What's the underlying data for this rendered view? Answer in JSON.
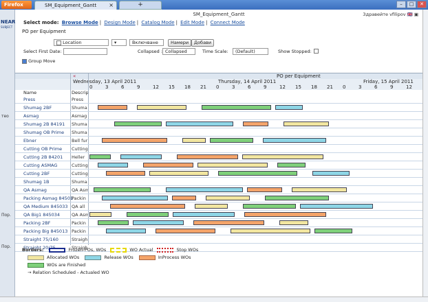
{
  "browser": {
    "menu_label": "Firefox",
    "tab_title": "SM_Equipment_Gantt",
    "new_tab_label": "+"
  },
  "logo": {
    "name": "NEARSOFT",
    "sub": "SUBJECT"
  },
  "left_labels": [
    "теo",
    "Пор.",
    "Пор."
  ],
  "app": {
    "title": "SM_Equipment_Gantt",
    "greeting": "Здравейте vfilipov",
    "mode_label": "Select mode:",
    "modes": [
      "Browse Mode",
      "Design Mode",
      "Catalog Mode",
      "Edit Mode",
      "Connect Mode"
    ],
    "page_heading": "PO per Equipment"
  },
  "toolbar": {
    "location_label": "Location",
    "location_value": "",
    "filter_value": "Включване",
    "search_button": "Намери",
    "add_button": "Добави",
    "first_date_label": "Select First Date:",
    "collapsed_label": "Collapsed :",
    "collapsed_value": "Collapsed",
    "time_scale_label": "Time Scale:",
    "time_scale_value": "(Default)",
    "show_stopped_label": "Show Stopped:",
    "group_move_label": "Group Move"
  },
  "gantt": {
    "banner": "PO per Equipment",
    "days": [
      "Wednesday, 13 April 2011",
      "Thursday, 14 April 2011",
      "Friday, 15 April 2011"
    ],
    "hours": [
      "0",
      "3",
      "6",
      "9",
      "12",
      "15",
      "18",
      "21",
      "0",
      "3",
      "6",
      "9",
      "12",
      "15",
      "18",
      "21",
      "0",
      "3",
      "6",
      "9",
      "12"
    ],
    "col_name": "Name",
    "col_desc": "Descrip",
    "rows": [
      {
        "name": "Press",
        "desc": "Press"
      },
      {
        "name": "Shumag 2BF",
        "desc": "Shuma"
      },
      {
        "name": "Asmag",
        "desc": "Asmag"
      },
      {
        "name": "Shumag 2B 84191",
        "desc": "Shuma"
      },
      {
        "name": "Shumag OB Prime",
        "desc": "Shuma"
      },
      {
        "name": "Ebner",
        "desc": "Bell fur"
      },
      {
        "name": "Cutting OB Prime",
        "desc": "Cutting"
      },
      {
        "name": "Cutting 2B 84201",
        "desc": "Heller"
      },
      {
        "name": "Cutting ASMAG",
        "desc": "Cutting"
      },
      {
        "name": "Cutting 2BF",
        "desc": "Cutting"
      },
      {
        "name": "Shumag 1B",
        "desc": "Shuma"
      },
      {
        "name": "QA Asmag",
        "desc": "QA Asm"
      },
      {
        "name": "Packing Asmag 84501",
        "desc": "Packin"
      },
      {
        "name": "QA Medium 845033",
        "desc": "QA all"
      },
      {
        "name": "QA Big1 845034",
        "desc": "QA Asm"
      },
      {
        "name": "Packing 2BF",
        "desc": "Packin"
      },
      {
        "name": "Packing Big 845013",
        "desc": "Packin"
      },
      {
        "name": "Straight 75/160",
        "desc": "Straigh"
      },
      {
        "name": "Straight 20/75",
        "desc": "Straigh"
      }
    ]
  },
  "legend": {
    "borders_label": "Borders:",
    "frozen_label": "Frozen POs, WOs",
    "wo_actual_label": "WO Actual",
    "stop_label": "Stop WOs",
    "allocated_label": "Allocated WOs",
    "release_label": "Release WOs",
    "inprocess_label": "InProcess WOs",
    "finished_label": "WOs are Finished",
    "relation_label": "Relation Scheduled - Actualed WO"
  },
  "colors": {
    "allocated": "#f2e6a0",
    "release": "#8ed6e6",
    "inprocess": "#f4a46a",
    "finished": "#7fd07a",
    "frozen_border": "#1a2d8f",
    "stop_border": "#d02020"
  }
}
